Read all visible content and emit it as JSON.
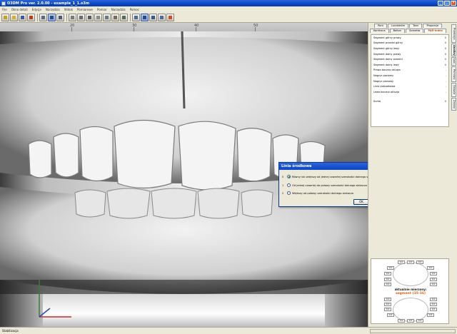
{
  "window": {
    "title": "O3DM Pro ver. 2.0.00 - example_1_1.o3m"
  },
  "menu": [
    "File",
    "Okno detali",
    "Edycja",
    "Narzędzia",
    "Widok",
    "Pomiarowe",
    "Pomiar",
    "Narzędzia",
    "Pomoc"
  ],
  "toolbar": {
    "buttons": [
      "new",
      "open",
      "save",
      "print",
      "undo",
      "view-front",
      "view-side",
      "view-top",
      "view-occlusal",
      "measure",
      "grid",
      "layers",
      "cut",
      "section",
      "rotate",
      "zoom",
      "pan",
      "light",
      "color",
      "reset"
    ]
  },
  "viewport": {
    "ruler_labels": [
      "20",
      "30",
      "40",
      "50"
    ]
  },
  "dialog": {
    "title": "Linia środkowa",
    "options": [
      {
        "num": "0",
        "label": "Równy lub większy od jednej czwartej szerokości dolnego s",
        "selected": true
      },
      {
        "num": "1",
        "label": "Od jednej czwartej do połowy szerokości dolnego siekacza",
        "selected": false
      },
      {
        "num": "2",
        "label": "Większy od połowy szerokości dolnego siekacza",
        "selected": false
      }
    ],
    "ok_label": "OK"
  },
  "panel": {
    "tabs_row1": [
      "Pont",
      "Lundström",
      "Tonn",
      "Proporcje"
    ],
    "tabs_row2": [
      "Korkhaus",
      "Bolton",
      "Sometta",
      "PAR-Index"
    ],
    "active_tab": "PAR-Index",
    "side_tabs": [
      "Przekroje",
      "Analizy",
      "Łuki",
      "Pomiary",
      "Okluzja",
      "Zarysy"
    ],
    "active_side_tab": "Analizy",
    "measurements": [
      {
        "label": "Segment górny prawy",
        "value": "0"
      },
      {
        "label": "Segment przedni górny",
        "value": "0"
      },
      {
        "label": "Segment górny lewy",
        "value": "0"
      },
      {
        "label": "Segment dolny prawy",
        "value": "0"
      },
      {
        "label": "Segment dolny przedni",
        "value": "0"
      },
      {
        "label": "Segment dolny lewy",
        "value": "0"
      },
      {
        "label": "Prawa boczna okluzja",
        "value": "-"
      },
      {
        "label": "Nagryz poziomy",
        "value": "-"
      },
      {
        "label": "Nagryz pionowy",
        "value": "-"
      },
      {
        "label": "Linia pośrodkowa",
        "value": "-"
      },
      {
        "label": "Lewa boczna okluzja",
        "value": "-"
      }
    ],
    "suma_label": "Suma",
    "suma_value": "0",
    "tooth_value": "0,0",
    "measuring_label": "aktualnie mierzony:",
    "segment_label": "segment (15-16)"
  },
  "status": {
    "text": "Stabilizacja"
  },
  "colors": {
    "titlebar": "#0a46c8",
    "segment_accent": "#e05a10",
    "panel_bg": "#ece9d8"
  }
}
